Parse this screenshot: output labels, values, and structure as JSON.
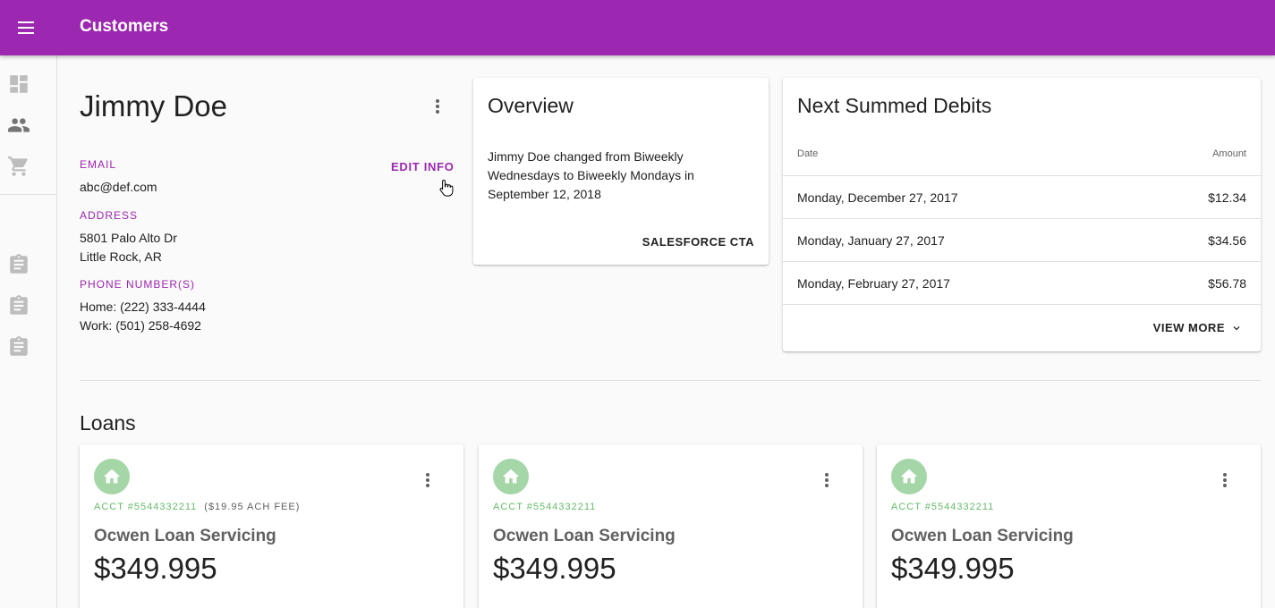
{
  "appbar": {
    "title": "Customers"
  },
  "colors": {
    "primary": "#9c27b0",
    "loan_accent": "#66bb6a",
    "loan_avatar": "#a5d6a7"
  },
  "rail": {
    "icons": [
      "dashboard-icon",
      "people-icon",
      "cart-icon",
      "assignment-icon",
      "assignment-icon",
      "assignment-icon"
    ]
  },
  "customer": {
    "name": "Jimmy Doe",
    "edit_label": "EDIT INFO",
    "email_label": "EMAIL",
    "email": "abc@def.com",
    "address_label": "ADDRESS",
    "address_line1": "5801 Palo Alto Dr",
    "address_line2": "Little Rock, AR",
    "phone_label": "PHONE NUMBER(S)",
    "phone_home": "Home: (222) 333-4444",
    "phone_work": "Work: (501) 258-4692"
  },
  "overview": {
    "title": "Overview",
    "text": "Jimmy Doe changed from Biweekly Wednesdays to Biweekly Mondays in September 12, 2018",
    "cta": "SALESFORCE CTA"
  },
  "debits": {
    "title": "Next Summed Debits",
    "col_date": "Date",
    "col_amount": "Amount",
    "rows": [
      {
        "date": "Monday, December 27, 2017",
        "amount": "$12.34"
      },
      {
        "date": "Monday, January 27, 2017",
        "amount": "$34.56"
      },
      {
        "date": "Monday, February 27, 2017",
        "amount": "$56.78"
      }
    ],
    "view_more": "VIEW MORE"
  },
  "loans": {
    "title": "Loans",
    "items": [
      {
        "acct": "ACCT #5544332211",
        "fee": "($19.95 ACH FEE)",
        "servicer": "Ocwen Loan Servicing",
        "amount": "$349.995"
      },
      {
        "acct": "ACCT #5544332211",
        "fee": "",
        "servicer": "Ocwen Loan Servicing",
        "amount": "$349.995"
      },
      {
        "acct": "ACCT #5544332211",
        "fee": "",
        "servicer": "Ocwen Loan Servicing",
        "amount": "$349.995"
      }
    ]
  }
}
